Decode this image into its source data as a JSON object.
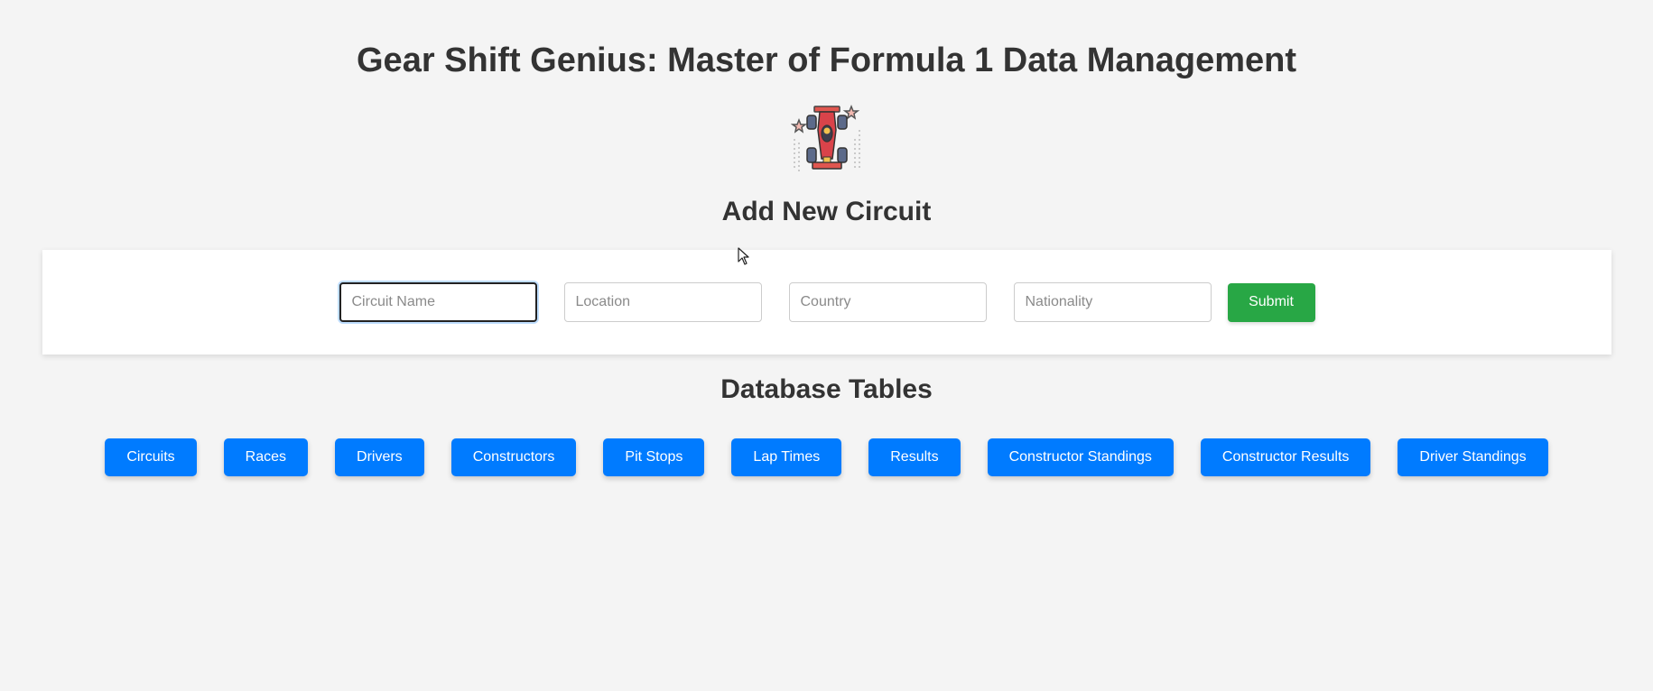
{
  "header": {
    "title": "Gear Shift Genius: Master of Formula 1 Data Management",
    "logo_icon": "race-car-icon"
  },
  "form": {
    "title": "Add New Circuit",
    "fields": {
      "circuit_name": {
        "placeholder": "Circuit Name",
        "value": ""
      },
      "location": {
        "placeholder": "Location",
        "value": ""
      },
      "country": {
        "placeholder": "Country",
        "value": ""
      },
      "nationality": {
        "placeholder": "Nationality",
        "value": ""
      }
    },
    "submit_label": "Submit"
  },
  "tables": {
    "title": "Database Tables",
    "buttons": [
      "Circuits",
      "Races",
      "Drivers",
      "Constructors",
      "Pit Stops",
      "Lap Times",
      "Results",
      "Constructor Standings",
      "Constructor Results",
      "Driver Standings"
    ]
  },
  "colors": {
    "background": "#f4f4f4",
    "primary_button": "#007bff",
    "submit_button": "#28a745",
    "text": "#333333"
  }
}
